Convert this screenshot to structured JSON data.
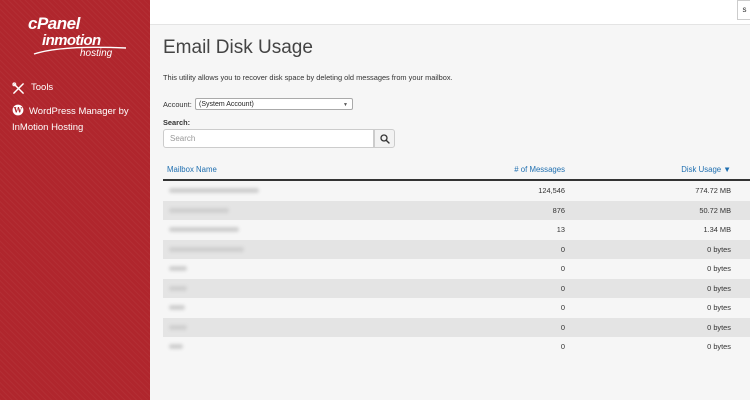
{
  "sidebar": {
    "logo": {
      "cpanel": "cPanel",
      "inmotion": "inmotion",
      "hosting": "hosting"
    },
    "items": [
      {
        "label": "Tools",
        "icon": "tools-icon"
      },
      {
        "label": "WordPress Manager by InMotion Hosting",
        "icon": "wordpress-icon"
      }
    ]
  },
  "topbar": {
    "button_label": "s"
  },
  "page": {
    "title": "Email Disk Usage",
    "description": "This utility allows you to recover disk space by deleting old messages from your mailbox."
  },
  "account": {
    "label": "Account:",
    "value": "(System Account)"
  },
  "search": {
    "label": "Search:",
    "placeholder": "Search"
  },
  "table": {
    "headers": {
      "name": "Mailbox Name",
      "messages": "# of Messages",
      "usage": "Disk Usage ▼"
    },
    "rows": [
      {
        "messages": "124,546",
        "usage": "774.72 MB"
      },
      {
        "messages": "876",
        "usage": "50.72 MB"
      },
      {
        "messages": "13",
        "usage": "1.34 MB"
      },
      {
        "messages": "0",
        "usage": "0 bytes"
      },
      {
        "messages": "0",
        "usage": "0 bytes"
      },
      {
        "messages": "0",
        "usage": "0 bytes"
      },
      {
        "messages": "0",
        "usage": "0 bytes"
      },
      {
        "messages": "0",
        "usage": "0 bytes"
      },
      {
        "messages": "0",
        "usage": "0 bytes"
      }
    ]
  },
  "colors": {
    "sidebar": "#b0262d",
    "link": "#1f6fb0",
    "row_alt": "#e4e4e4"
  }
}
